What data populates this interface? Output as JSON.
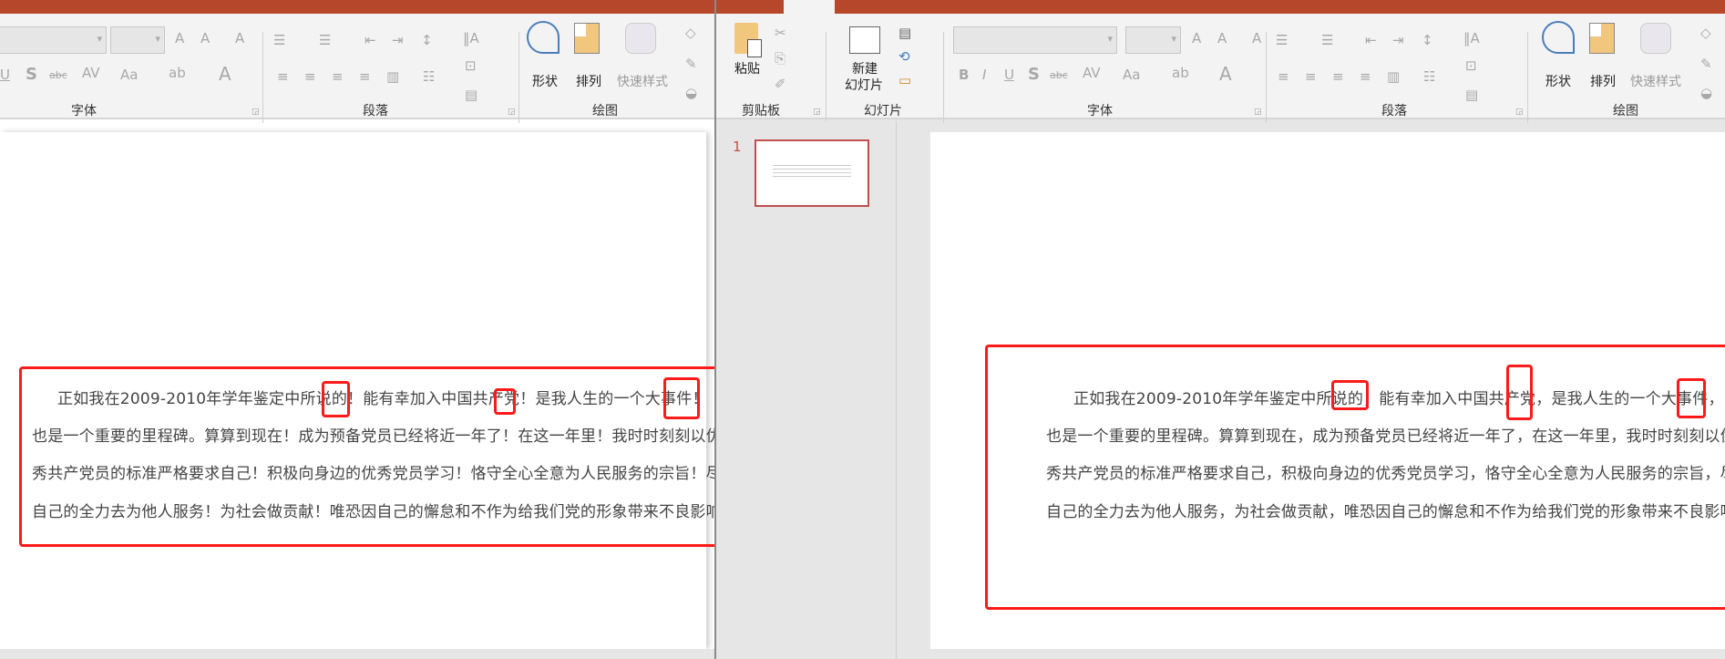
{
  "left_window": {
    "ribbon_groups": {
      "font": "字体",
      "paragraph": "段落",
      "drawing": "绘图"
    },
    "drawing_buttons": {
      "shapes": "形状",
      "arrange": "排列",
      "quick_styles": "快速样式"
    },
    "paragraph_lines": [
      "正如我在2009-2010年学年鉴定中所说的！能有幸加入中国共产党！是我人生的一个大事件！",
      "也是一个重要的里程碑。算算到现在！成为预备党员已经将近一年了！在这一年里！我时时刻刻以优",
      "秀共产党员的标准严格要求自己！积极向身边的优秀党员学习！恪守全心全意为人民服务的宗旨！尽",
      "自己的全力去为他人服务！为社会做贡献！唯恐因自己的懈怠和不作为给我们党的形象带来不良影响。"
    ]
  },
  "right_window": {
    "ribbon_groups": {
      "clipboard": "剪贴板",
      "slides": "幻灯片",
      "font": "字体",
      "paragraph": "段落",
      "drawing": "绘图"
    },
    "clipboard_buttons": {
      "paste": "粘贴"
    },
    "slides_buttons": {
      "new_slide_line1": "新建",
      "new_slide_line2": "幻灯片"
    },
    "drawing_buttons": {
      "shapes": "形状",
      "arrange": "排列",
      "quick_styles": "快速样式"
    },
    "slide_number": "1",
    "paragraph_lines": [
      "正如我在2009-2010年学年鉴定中所说的，能有幸加入中国共产党，是我人生的一个大事件，",
      "也是一个重要的里程碑。算算到现在，成为预备党员已经将近一年了，在这一年里，我时时刻刻以优",
      "秀共产党员的标准严格要求自己，积极向身边的优秀党员学习，恪守全心全意为人民服务的宗旨，尽",
      "自己的全力去为他人服务，为社会做贡献，唯恐因自己的懈怠和不作为给我们党的形象带来不良影响。"
    ]
  },
  "colors": {
    "tab_bar": "#b7472a",
    "annotation": "#ff1a1a",
    "slide_number": "#c0504d"
  }
}
